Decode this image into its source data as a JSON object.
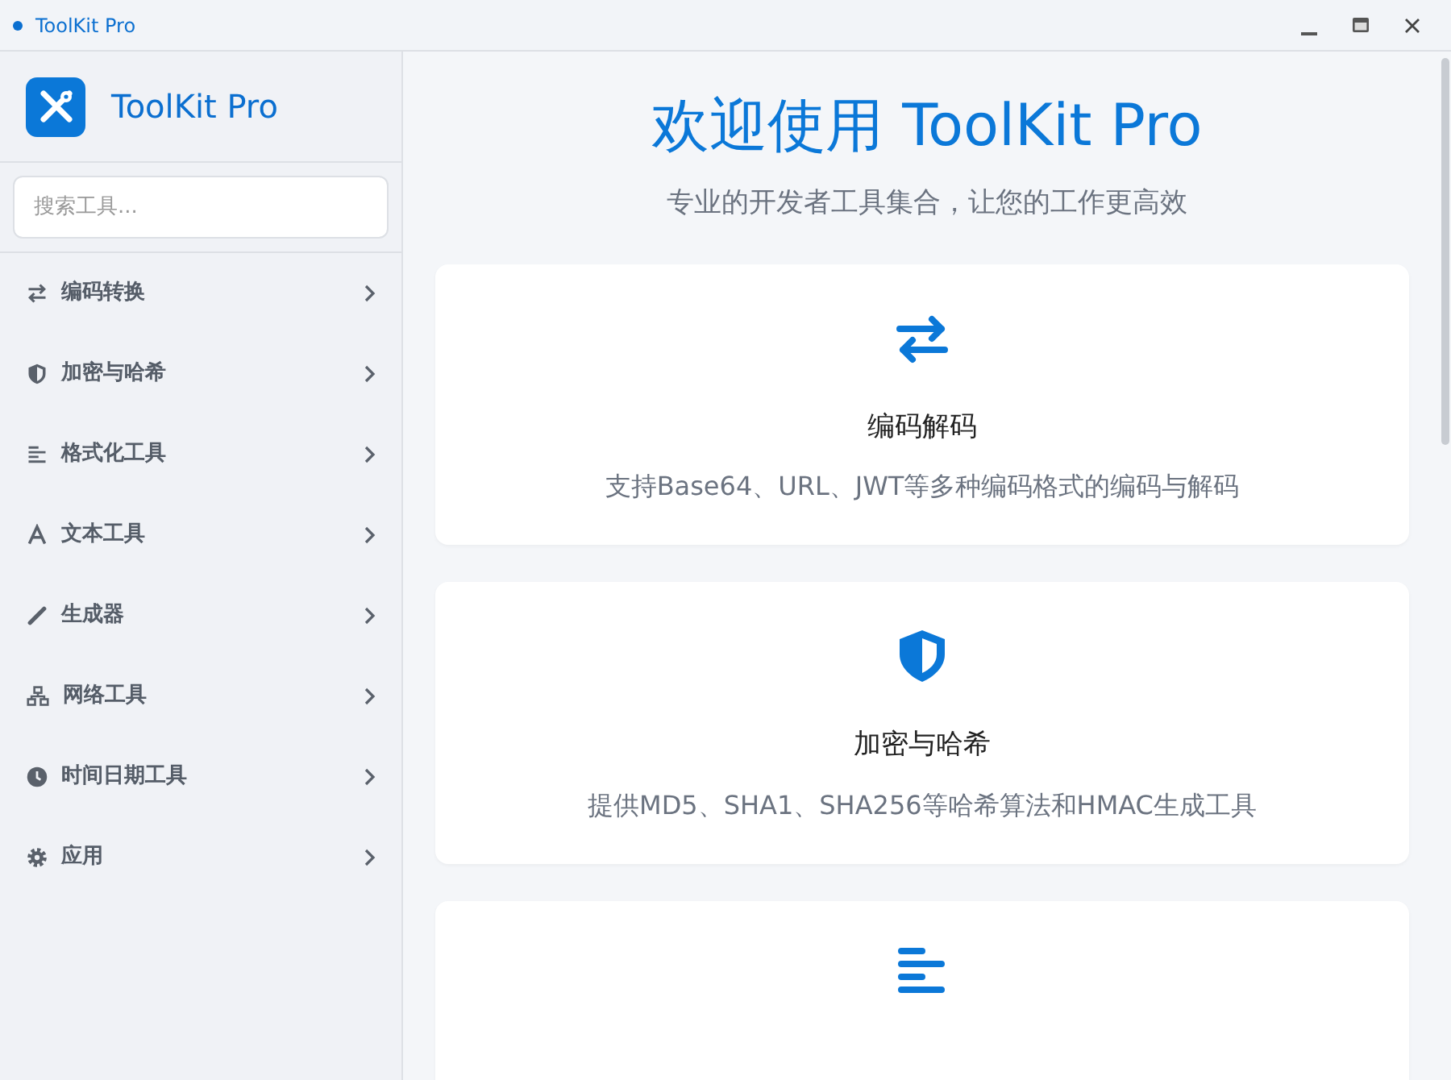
{
  "window": {
    "title": "ToolKit Pro"
  },
  "sidebar": {
    "brand": "ToolKit Pro",
    "search": {
      "placeholder": "搜索工具..."
    },
    "items": [
      {
        "label": "编码转换",
        "expanded": false
      },
      {
        "label": "加密与哈希",
        "expanded": false
      },
      {
        "label": "格式化工具",
        "expanded": false
      },
      {
        "label": "文本工具",
        "expanded": false
      },
      {
        "label": "生成器",
        "expanded": false
      },
      {
        "label": "网络工具",
        "expanded": false
      },
      {
        "label": "时间日期工具",
        "expanded": false
      },
      {
        "label": "应用",
        "expanded": false
      }
    ]
  },
  "main": {
    "title": "欢迎使用 ToolKit Pro",
    "subtitle": "专业的开发者工具集合，让您的工作更高效",
    "cards": [
      {
        "kind": "full",
        "title": "编码解码",
        "description": "支持Base64、URL、JWT等多种编码格式的编码与解码"
      },
      {
        "kind": "full",
        "title": "加密与哈希",
        "description": "提供MD5、SHA1、SHA256等哈希算法和HMAC生成工具"
      },
      {
        "kind": "cut"
      }
    ]
  }
}
